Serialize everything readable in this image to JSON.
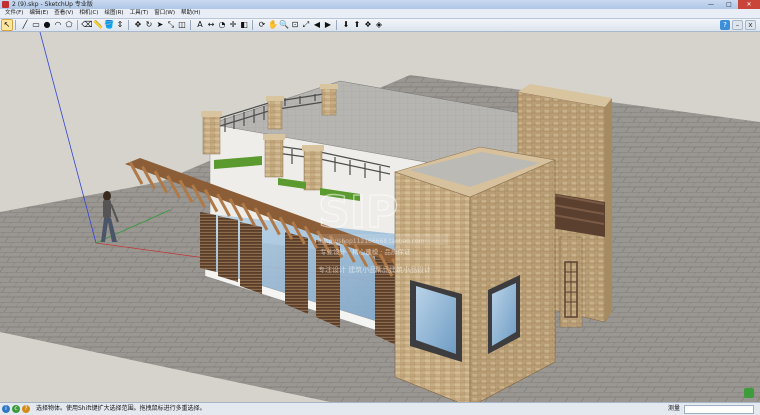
{
  "window": {
    "title": "2 (9).skp - SketchUp 专业版"
  },
  "menu": {
    "items": [
      "文件(F)",
      "编辑(E)",
      "查看(V)",
      "相机(C)",
      "绘图(R)",
      "工具(T)",
      "窗口(W)",
      "帮助(H)"
    ]
  },
  "toolbar": {
    "tools": [
      {
        "name": "select-icon",
        "glyph": "↖"
      },
      {
        "name": "line-icon",
        "glyph": "╱"
      },
      {
        "name": "rectangle-icon",
        "glyph": "▭"
      },
      {
        "name": "circle-icon",
        "glyph": "●"
      },
      {
        "name": "arc-icon",
        "glyph": "◠"
      },
      {
        "name": "polygon-icon",
        "glyph": "⬠"
      },
      {
        "name": "eraser-icon",
        "glyph": "⌫"
      },
      {
        "name": "tape-measure-icon",
        "glyph": "📏"
      },
      {
        "name": "paint-bucket-icon",
        "glyph": "🪣"
      },
      {
        "name": "push-pull-icon",
        "glyph": "⇕"
      },
      {
        "name": "move-icon",
        "glyph": "✥"
      },
      {
        "name": "rotate-icon",
        "glyph": "↻"
      },
      {
        "name": "follow-me-icon",
        "glyph": "➤"
      },
      {
        "name": "scale-icon",
        "glyph": "⤡"
      },
      {
        "name": "offset-icon",
        "glyph": "◫"
      },
      {
        "name": "text-icon",
        "glyph": "A"
      },
      {
        "name": "dimension-icon",
        "glyph": "↔"
      },
      {
        "name": "protractor-icon",
        "glyph": "◔"
      },
      {
        "name": "axes-icon",
        "glyph": "✛"
      },
      {
        "name": "section-plane-icon",
        "glyph": "◧"
      },
      {
        "name": "orbit-icon",
        "glyph": "⟳"
      },
      {
        "name": "pan-icon",
        "glyph": "✋"
      },
      {
        "name": "zoom-icon",
        "glyph": "🔍"
      },
      {
        "name": "zoom-window-icon",
        "glyph": "⊡"
      },
      {
        "name": "zoom-extents-icon",
        "glyph": "⤢"
      },
      {
        "name": "previous-view-icon",
        "glyph": "◀"
      },
      {
        "name": "next-view-icon",
        "glyph": "▶"
      },
      {
        "name": "get-models-icon",
        "glyph": "⬇"
      },
      {
        "name": "share-model-icon",
        "glyph": "⬆"
      },
      {
        "name": "components-icon",
        "glyph": "❖"
      },
      {
        "name": "extension-icon",
        "glyph": "◈"
      }
    ]
  },
  "watermark": {
    "line1": "http://shop112166668.taobao.com",
    "line2": "专业设计 · 精心建模 · 品质保证",
    "line3": "专注设计 建筑小品",
    "line4": "精品建筑小品设计"
  },
  "status": {
    "message": "选择物体。使用Shift键扩大选择范围。拖拽鼠标进行多重选择。",
    "measurement_label": "测量",
    "measurement_value": ""
  },
  "colors": {
    "sky": "#d5d3cc",
    "ground": "#9a9792",
    "stone": "#c9b189",
    "wood": "#9a6a3f"
  }
}
